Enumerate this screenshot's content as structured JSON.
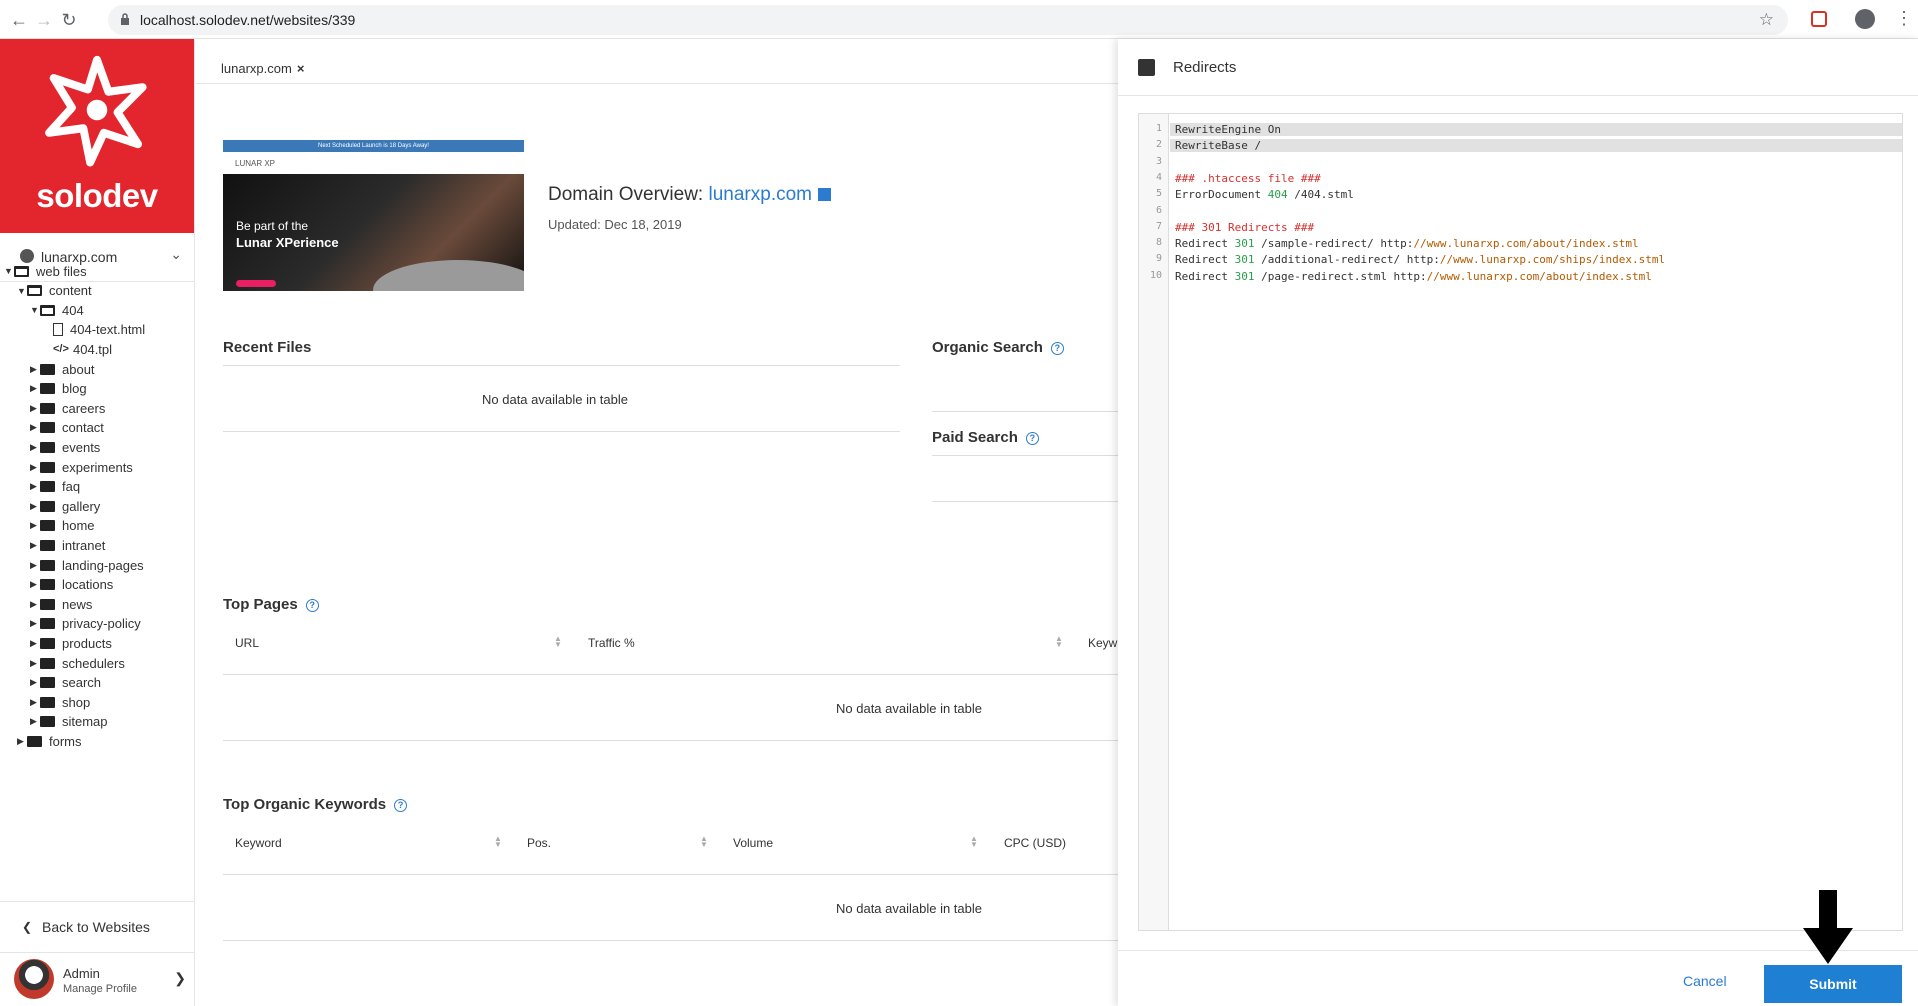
{
  "browser": {
    "url": "localhost.solodev.net/websites/339"
  },
  "sidebar": {
    "brand": "solodev",
    "site_selector": "lunarxp.com",
    "tree": [
      {
        "label": "web files",
        "level": 0,
        "type": "folder-open",
        "expanded": true
      },
      {
        "label": "content",
        "level": 1,
        "type": "folder-open",
        "expanded": true
      },
      {
        "label": "404",
        "level": 2,
        "type": "folder-open",
        "expanded": true
      },
      {
        "label": "404-text.html",
        "level": 3,
        "type": "file"
      },
      {
        "label": "404.tpl",
        "level": 3,
        "type": "code"
      },
      {
        "label": "about",
        "level": 2,
        "type": "folder"
      },
      {
        "label": "blog",
        "level": 2,
        "type": "folder"
      },
      {
        "label": "careers",
        "level": 2,
        "type": "folder"
      },
      {
        "label": "contact",
        "level": 2,
        "type": "folder"
      },
      {
        "label": "events",
        "level": 2,
        "type": "folder"
      },
      {
        "label": "experiments",
        "level": 2,
        "type": "folder"
      },
      {
        "label": "faq",
        "level": 2,
        "type": "folder"
      },
      {
        "label": "gallery",
        "level": 2,
        "type": "folder"
      },
      {
        "label": "home",
        "level": 2,
        "type": "folder"
      },
      {
        "label": "intranet",
        "level": 2,
        "type": "folder"
      },
      {
        "label": "landing-pages",
        "level": 2,
        "type": "folder"
      },
      {
        "label": "locations",
        "level": 2,
        "type": "folder"
      },
      {
        "label": "news",
        "level": 2,
        "type": "folder"
      },
      {
        "label": "privacy-policy",
        "level": 2,
        "type": "folder"
      },
      {
        "label": "products",
        "level": 2,
        "type": "folder"
      },
      {
        "label": "schedulers",
        "level": 2,
        "type": "folder"
      },
      {
        "label": "search",
        "level": 2,
        "type": "folder"
      },
      {
        "label": "shop",
        "level": 2,
        "type": "folder"
      },
      {
        "label": "sitemap",
        "level": 2,
        "type": "folder"
      },
      {
        "label": "forms",
        "level": 1,
        "type": "folder"
      }
    ],
    "back_label": "Back to Websites",
    "profile": {
      "name": "Admin",
      "sub": "Manage Profile"
    }
  },
  "main": {
    "tab": "lunarxp.com",
    "thumbnail": {
      "banner": "Next Scheduled Launch is 18 Days Away!",
      "logo": "LUNAR XP",
      "hero_line1": "Be part of the",
      "hero_line2": "Lunar XPerience"
    },
    "overview_prefix": "Domain Overview: ",
    "overview_domain": "lunarxp.com",
    "updated": "Updated: Dec 18, 2019",
    "recent_files": {
      "title": "Recent Files",
      "empty": "No data available in table"
    },
    "organic_search": {
      "title": "Organic Search"
    },
    "paid_search": {
      "title": "Paid Search"
    },
    "top_pages": {
      "title": "Top Pages",
      "columns": [
        "URL",
        "Traffic %",
        "Keyw"
      ],
      "empty": "No data available in table"
    },
    "top_keywords": {
      "title": "Top Organic Keywords",
      "columns": [
        "Keyword",
        "Pos.",
        "Volume",
        "CPC (USD)"
      ],
      "empty": "No data available in table"
    }
  },
  "panel": {
    "title": "Redirects",
    "code_lines": [
      {
        "n": "1",
        "text": "RewriteEngine On"
      },
      {
        "n": "2",
        "text": "RewriteBase /"
      },
      {
        "n": "3",
        "text": ""
      },
      {
        "n": "4",
        "text": "### .htaccess file ###"
      },
      {
        "n": "5",
        "text": "ErrorDocument 404 /404.stml"
      },
      {
        "n": "6",
        "text": ""
      },
      {
        "n": "7",
        "text": "### 301 Redirects ###"
      },
      {
        "n": "8",
        "text": "Redirect 301 /sample-redirect/ http://www.lunarxp.com/about/index.stml"
      },
      {
        "n": "9",
        "text": "Redirect 301 /additional-redirect/ http://www.lunarxp.com/ships/index.stml"
      },
      {
        "n": "10",
        "text": "Redirect 301 /page-redirect.stml http://www.lunarxp.com/about/index.stml"
      }
    ],
    "cancel_label": "Cancel",
    "submit_label": "Submit"
  }
}
